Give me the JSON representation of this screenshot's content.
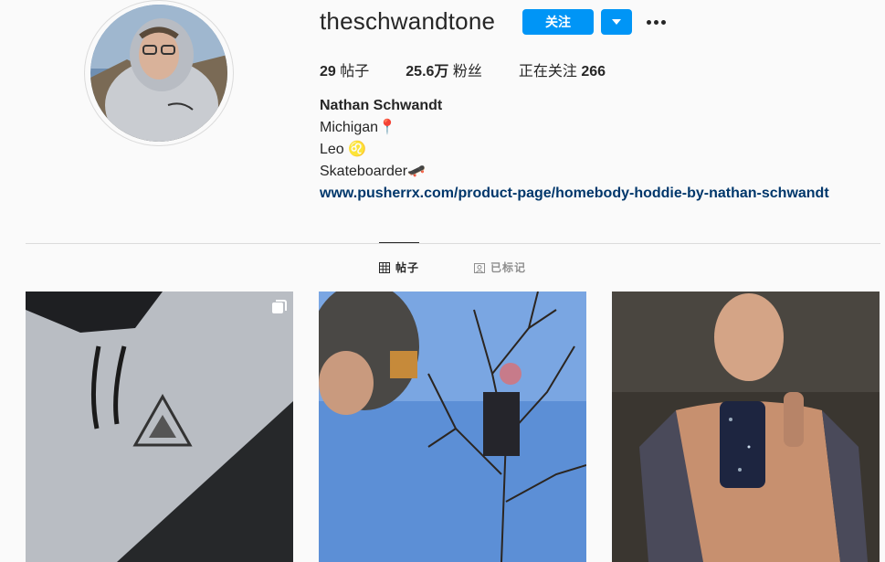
{
  "profile": {
    "username": "theschwandtone",
    "follow_label": "关注",
    "stats": {
      "posts_count": "29",
      "posts_label": "帖子",
      "followers_count": "25.6万",
      "followers_label": "粉丝",
      "following_label": "正在关注",
      "following_count": "266"
    },
    "bio": {
      "name": "Nathan Schwandt",
      "line1": "Michigan📍",
      "line2": "Leo ♌️",
      "line3": "Skateboarder🛹",
      "link": "www.pusherrx.com/product-page/homebody-hoddie-by-nathan-schwandt"
    }
  },
  "tabs": {
    "posts_label": "帖子",
    "tagged_label": "已标记"
  },
  "colors": {
    "accent": "#0095f6",
    "link": "#00376b",
    "background": "#fafafa"
  },
  "icons": [
    "chevron-down-icon",
    "more-options-icon",
    "grid-icon",
    "tagged-icon",
    "multiple-photos-icon"
  ]
}
